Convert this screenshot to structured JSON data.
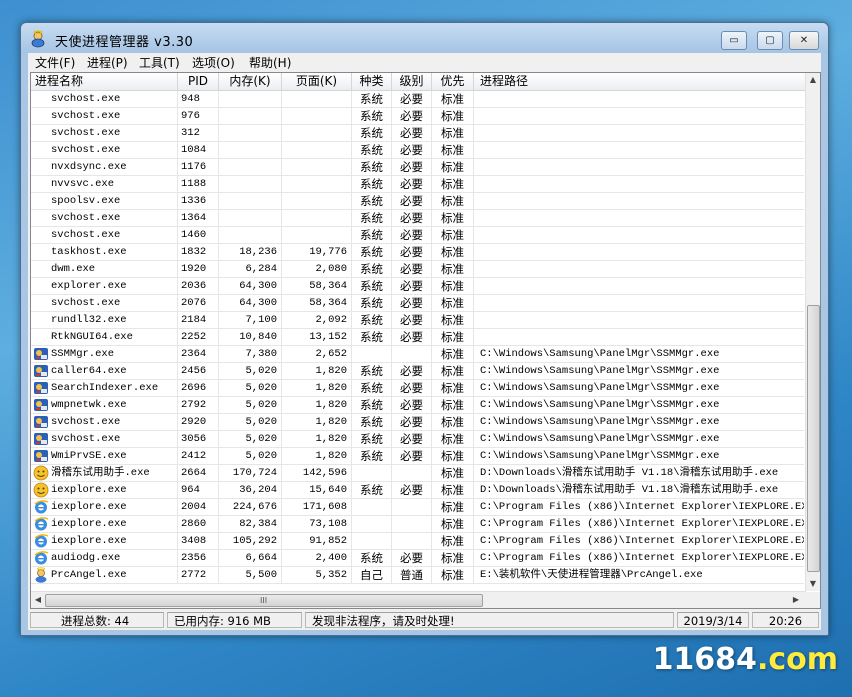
{
  "window": {
    "title": "天使进程管理器 v3.30",
    "buttons": {
      "minimize": "▭",
      "maximize": "▢",
      "close": "✕"
    }
  },
  "menu": [
    {
      "label": "文件(F)"
    },
    {
      "label": "进程(P)"
    },
    {
      "label": "工具(T)"
    },
    {
      "label": "选项(O)"
    },
    {
      "label": "帮助(H)"
    }
  ],
  "columns": {
    "name": "进程名称",
    "pid": "PID",
    "mem": "内存(K)",
    "page": "页面(K)",
    "type": "种类",
    "level": "级别",
    "prio": "优先",
    "path": "进程路径"
  },
  "rows": [
    {
      "icon": "",
      "name": "svchost.exe",
      "pid": "948",
      "mem": "",
      "page": "",
      "type": "系统",
      "level": "必要",
      "prio": "标准",
      "path": ""
    },
    {
      "icon": "",
      "name": "svchost.exe",
      "pid": "976",
      "mem": "",
      "page": "",
      "type": "系统",
      "level": "必要",
      "prio": "标准",
      "path": ""
    },
    {
      "icon": "",
      "name": "svchost.exe",
      "pid": "312",
      "mem": "",
      "page": "",
      "type": "系统",
      "level": "必要",
      "prio": "标准",
      "path": ""
    },
    {
      "icon": "",
      "name": "svchost.exe",
      "pid": "1084",
      "mem": "",
      "page": "",
      "type": "系统",
      "level": "必要",
      "prio": "标准",
      "path": ""
    },
    {
      "icon": "",
      "name": "nvxdsync.exe",
      "pid": "1176",
      "mem": "",
      "page": "",
      "type": "系统",
      "level": "必要",
      "prio": "标准",
      "path": ""
    },
    {
      "icon": "",
      "name": "nvvsvc.exe",
      "pid": "1188",
      "mem": "",
      "page": "",
      "type": "系统",
      "level": "必要",
      "prio": "标准",
      "path": ""
    },
    {
      "icon": "",
      "name": "spoolsv.exe",
      "pid": "1336",
      "mem": "",
      "page": "",
      "type": "系统",
      "level": "必要",
      "prio": "标准",
      "path": ""
    },
    {
      "icon": "",
      "name": "svchost.exe",
      "pid": "1364",
      "mem": "",
      "page": "",
      "type": "系统",
      "level": "必要",
      "prio": "标准",
      "path": ""
    },
    {
      "icon": "",
      "name": "svchost.exe",
      "pid": "1460",
      "mem": "",
      "page": "",
      "type": "系统",
      "level": "必要",
      "prio": "标准",
      "path": ""
    },
    {
      "icon": "",
      "name": "taskhost.exe",
      "pid": "1832",
      "mem": "18,236",
      "page": "19,776",
      "type": "系统",
      "level": "必要",
      "prio": "标准",
      "path": ""
    },
    {
      "icon": "",
      "name": "dwm.exe",
      "pid": "1920",
      "mem": "6,284",
      "page": "2,080",
      "type": "系统",
      "level": "必要",
      "prio": "标准",
      "path": ""
    },
    {
      "icon": "",
      "name": "explorer.exe",
      "pid": "2036",
      "mem": "64,300",
      "page": "58,364",
      "type": "系统",
      "level": "必要",
      "prio": "标准",
      "path": ""
    },
    {
      "icon": "",
      "name": "svchost.exe",
      "pid": "2076",
      "mem": "64,300",
      "page": "58,364",
      "type": "系统",
      "level": "必要",
      "prio": "标准",
      "path": ""
    },
    {
      "icon": "",
      "name": "rundll32.exe",
      "pid": "2184",
      "mem": "7,100",
      "page": "2,092",
      "type": "系统",
      "level": "必要",
      "prio": "标准",
      "path": ""
    },
    {
      "icon": "",
      "name": "RtkNGUI64.exe",
      "pid": "2252",
      "mem": "10,840",
      "page": "13,152",
      "type": "系统",
      "level": "必要",
      "prio": "标准",
      "path": ""
    },
    {
      "icon": "samsung-app-icon",
      "name": "SSMMgr.exe",
      "pid": "2364",
      "mem": "7,380",
      "page": "2,652",
      "type": "",
      "level": "",
      "prio": "标准",
      "path": "C:\\Windows\\Samsung\\PanelMgr\\SSMMgr.exe"
    },
    {
      "icon": "samsung-app-icon",
      "name": "caller64.exe",
      "pid": "2456",
      "mem": "5,020",
      "page": "1,820",
      "type": "系统",
      "level": "必要",
      "prio": "标准",
      "path": "C:\\Windows\\Samsung\\PanelMgr\\SSMMgr.exe"
    },
    {
      "icon": "samsung-app-icon",
      "name": "SearchIndexer.exe",
      "pid": "2696",
      "mem": "5,020",
      "page": "1,820",
      "type": "系统",
      "level": "必要",
      "prio": "标准",
      "path": "C:\\Windows\\Samsung\\PanelMgr\\SSMMgr.exe"
    },
    {
      "icon": "samsung-app-icon",
      "name": "wmpnetwk.exe",
      "pid": "2792",
      "mem": "5,020",
      "page": "1,820",
      "type": "系统",
      "level": "必要",
      "prio": "标准",
      "path": "C:\\Windows\\Samsung\\PanelMgr\\SSMMgr.exe"
    },
    {
      "icon": "samsung-app-icon",
      "name": "svchost.exe",
      "pid": "2920",
      "mem": "5,020",
      "page": "1,820",
      "type": "系统",
      "level": "必要",
      "prio": "标准",
      "path": "C:\\Windows\\Samsung\\PanelMgr\\SSMMgr.exe"
    },
    {
      "icon": "samsung-app-icon",
      "name": "svchost.exe",
      "pid": "3056",
      "mem": "5,020",
      "page": "1,820",
      "type": "系统",
      "level": "必要",
      "prio": "标准",
      "path": "C:\\Windows\\Samsung\\PanelMgr\\SSMMgr.exe"
    },
    {
      "icon": "samsung-app-icon",
      "name": "WmiPrvSE.exe",
      "pid": "2412",
      "mem": "5,020",
      "page": "1,820",
      "type": "系统",
      "level": "必要",
      "prio": "标准",
      "path": "C:\\Windows\\Samsung\\PanelMgr\\SSMMgr.exe"
    },
    {
      "icon": "smiley-icon",
      "name": "滑稽东试用助手.exe",
      "pid": "2664",
      "mem": "170,724",
      "page": "142,596",
      "type": "",
      "level": "",
      "prio": "标准",
      "path": "D:\\Downloads\\滑稽东试用助手 V1.18\\滑稽东试用助手.exe"
    },
    {
      "icon": "smiley-icon",
      "name": "iexplore.exe",
      "pid": "964",
      "mem": "36,204",
      "page": "15,640",
      "type": "系统",
      "level": "必要",
      "prio": "标准",
      "path": "D:\\Downloads\\滑稽东试用助手 V1.18\\滑稽东试用助手.exe"
    },
    {
      "icon": "ie-icon",
      "name": "iexplore.exe",
      "pid": "2004",
      "mem": "224,676",
      "page": "171,608",
      "type": "",
      "level": "",
      "prio": "标准",
      "path": "C:\\Program Files (x86)\\Internet Explorer\\IEXPLORE.EXE"
    },
    {
      "icon": "ie-icon",
      "name": "iexplore.exe",
      "pid": "2860",
      "mem": "82,384",
      "page": "73,108",
      "type": "",
      "level": "",
      "prio": "标准",
      "path": "C:\\Program Files (x86)\\Internet Explorer\\IEXPLORE.EXE"
    },
    {
      "icon": "ie-icon",
      "name": "iexplore.exe",
      "pid": "3408",
      "mem": "105,292",
      "page": "91,852",
      "type": "",
      "level": "",
      "prio": "标准",
      "path": "C:\\Program Files (x86)\\Internet Explorer\\IEXPLORE.EXE"
    },
    {
      "icon": "ie-icon",
      "name": "audiodg.exe",
      "pid": "2356",
      "mem": "6,664",
      "page": "2,400",
      "type": "系统",
      "level": "必要",
      "prio": "标准",
      "path": "C:\\Program Files (x86)\\Internet Explorer\\IEXPLORE.EXE"
    },
    {
      "icon": "angel-app-icon",
      "name": "PrcAngel.exe",
      "pid": "2772",
      "mem": "5,500",
      "page": "5,352",
      "type": "自己",
      "level": "普通",
      "prio": "标准",
      "path": "E:\\装机软件\\天使进程管理器\\PrcAngel.exe"
    }
  ],
  "scrollbar": {
    "grip": "III"
  },
  "status": {
    "process_count": "进程总数: 44",
    "memory_used": "已用内存: 916 MB",
    "message": "发现非法程序，请及时处理!",
    "date": "2019/3/14",
    "time": "20:26"
  },
  "watermark": {
    "text": "11684",
    "suffix": ".com"
  },
  "colors": {
    "desktop": "#3d8fcf",
    "window_frame": "#a9c6e4",
    "list_bg": "#ffffff"
  }
}
